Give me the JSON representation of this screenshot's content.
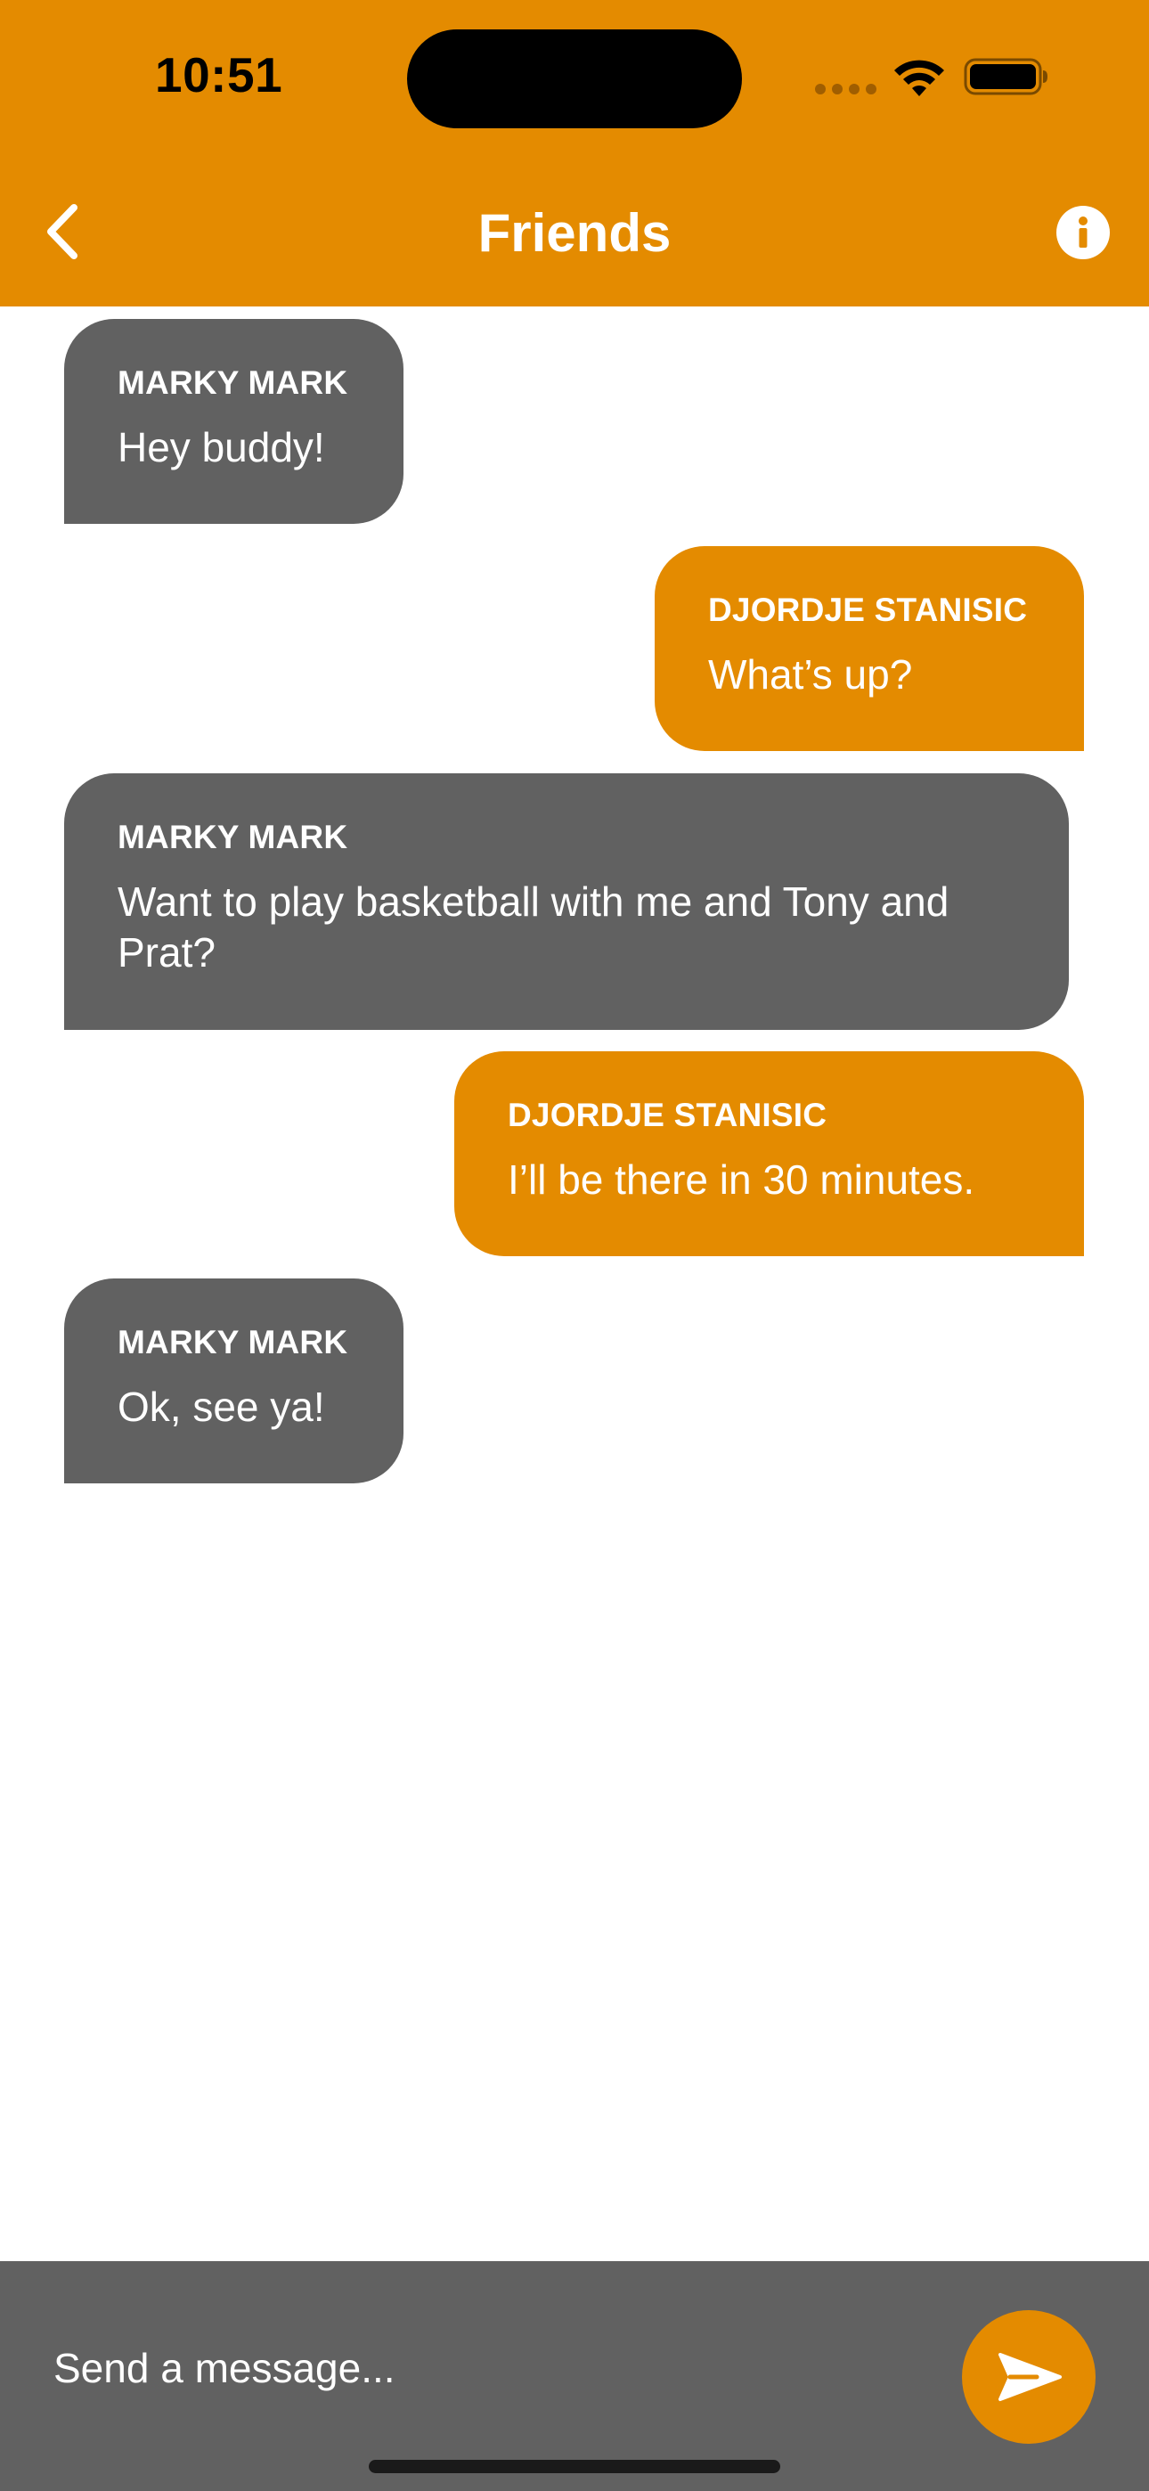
{
  "status_bar": {
    "time": "10:51"
  },
  "nav": {
    "title": "Friends",
    "back_icon": "chevron-left-icon",
    "info_icon": "info-icon"
  },
  "messages": [
    {
      "direction": "received",
      "sender": "MARKY MARK",
      "text": "Hey buddy!"
    },
    {
      "direction": "sent",
      "sender": "DJORDJE STANISIC",
      "text": "What’s up?"
    },
    {
      "direction": "received",
      "sender": "MARKY MARK",
      "text": "Want to play basketball with me and Tony and Prat?"
    },
    {
      "direction": "sent",
      "sender": "DJORDJE STANISIC",
      "text": "I’ll be there in 30 minutes."
    },
    {
      "direction": "received",
      "sender": "MARKY MARK",
      "text": "Ok, see ya!"
    }
  ],
  "composer": {
    "placeholder": "Send a message...",
    "value": "",
    "send_icon": "send-icon"
  },
  "colors": {
    "accent": "#E48B00",
    "received_bubble": "#616161",
    "input_bar": "#616161",
    "text_on_accent": "#FFFFFF"
  }
}
